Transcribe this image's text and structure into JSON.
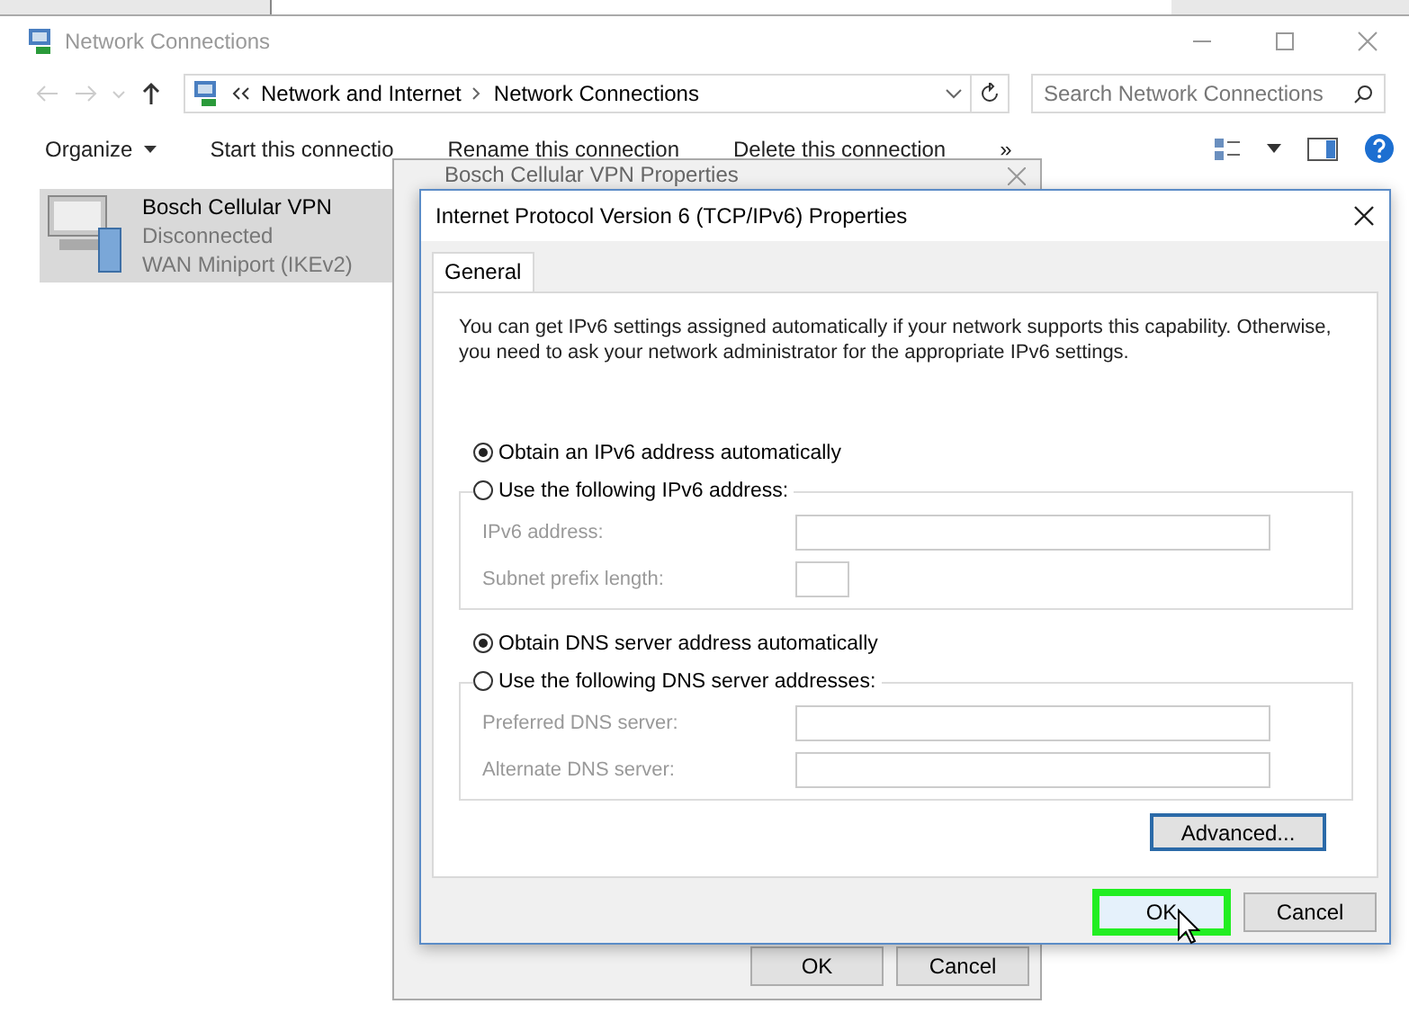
{
  "explorer": {
    "title": "Network Connections",
    "breadcrumb": [
      "Network and Internet",
      "Network Connections"
    ],
    "search": {
      "placeholder": "Search Network Connections"
    },
    "commands": [
      "Organize",
      "Start this connectio",
      "Rename this connection",
      "Delete this connection"
    ],
    "overflow": "»",
    "connections": [
      {
        "name": "Bosch Cellular VPN",
        "status": "Disconnected",
        "device": "WAN Miniport (IKEv2)",
        "selected": true
      }
    ]
  },
  "properties_dialog": {
    "title": "Bosch Cellular VPN Properties",
    "buttons": [
      "OK",
      "Cancel"
    ]
  },
  "ipv6_dialog": {
    "title": "Internet Protocol Version 6 (TCP/IPv6) Properties",
    "tabs": [
      {
        "label": "General",
        "selected": true
      }
    ],
    "description": "You can get IPv6 settings assigned automatically if your network supports this capability. Otherwise, you need to ask your network administrator for the appropriate IPv6 settings.",
    "sections": [
      {
        "options": [
          {
            "label": "Obtain an IPv6 address automatically",
            "selected": true
          },
          {
            "label": "Use the following IPv6 address:",
            "selected": false
          }
        ],
        "fields": [
          {
            "label": "IPv6 address:",
            "kind": "wide",
            "disabled": true
          },
          {
            "label": "Subnet prefix length:",
            "kind": "short",
            "disabled": true
          }
        ]
      },
      {
        "options": [
          {
            "label": "Obtain DNS server address automatically",
            "selected": true
          },
          {
            "label": "Use the following DNS server addresses:",
            "selected": false
          }
        ],
        "fields": [
          {
            "label": "Preferred DNS server:",
            "kind": "wide",
            "disabled": true
          },
          {
            "label": "Alternate DNS server:",
            "kind": "wide",
            "disabled": true
          }
        ]
      }
    ],
    "advanced_button": "Advanced...",
    "buttons": [
      {
        "label": "OK",
        "highlighted": true
      },
      {
        "label": "Cancel",
        "highlighted": false
      }
    ]
  }
}
